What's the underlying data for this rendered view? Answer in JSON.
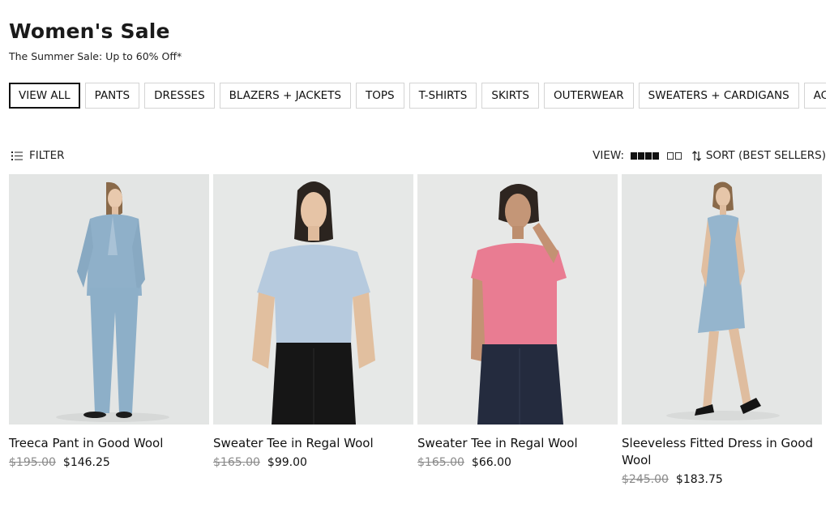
{
  "header": {
    "title": "Women's Sale",
    "subtitle": "The Summer Sale: Up to 60% Off*"
  },
  "categories": [
    {
      "label": "VIEW ALL",
      "active": true
    },
    {
      "label": "PANTS"
    },
    {
      "label": "DRESSES"
    },
    {
      "label": "BLAZERS + JACKETS"
    },
    {
      "label": "TOPS"
    },
    {
      "label": "T-SHIRTS"
    },
    {
      "label": "SKIRTS"
    },
    {
      "label": "OUTERWEAR"
    },
    {
      "label": "SWEATERS + CARDIGANS"
    },
    {
      "label": "ACCESSORIES"
    }
  ],
  "toolbar": {
    "filter_label": "FILTER",
    "filter_icon": "filter-list-icon",
    "view_label": "VIEW:",
    "sort_label": "SORT (BEST SELLERS)",
    "sort_icon": "sort-arrows-icon"
  },
  "products": [
    {
      "name": "Treeca Pant in Good Wool",
      "original_price": "$195.00",
      "sale_price": "$146.25",
      "photo": "model in light blue suit",
      "color": "#8fb0c9"
    },
    {
      "name": "Sweater Tee in Regal Wool",
      "original_price": "$165.00",
      "sale_price": "$99.00",
      "photo": "model in light blue tee",
      "color": "#b6cade"
    },
    {
      "name": "Sweater Tee in Regal Wool",
      "original_price": "$165.00",
      "sale_price": "$66.00",
      "photo": "model in pink tee",
      "color": "#e97c92"
    },
    {
      "name": "Sleeveless Fitted Dress in Good Wool",
      "original_price": "$245.00",
      "sale_price": "$183.75",
      "photo": "model in light blue dress",
      "color": "#95b5cd"
    }
  ]
}
